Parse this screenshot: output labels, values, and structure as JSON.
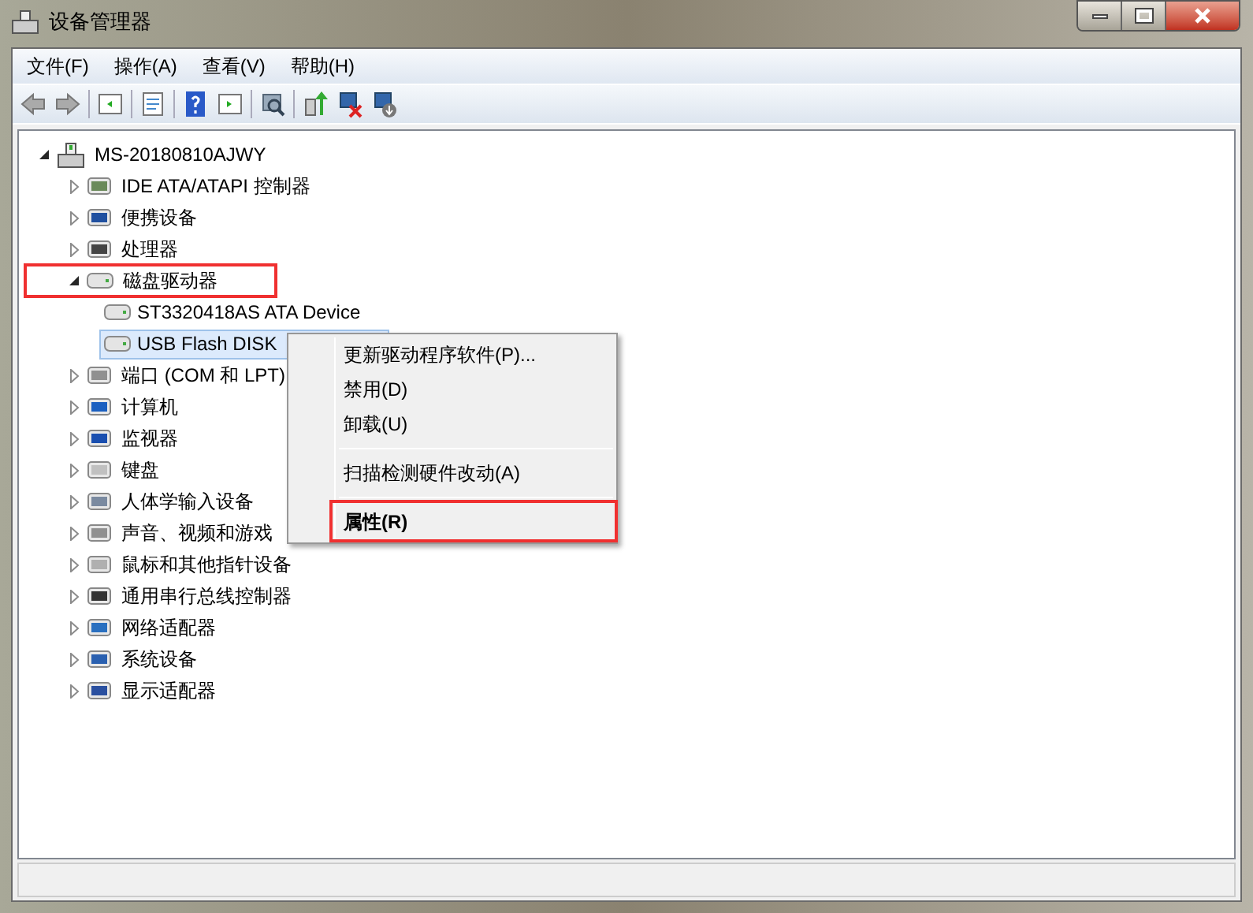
{
  "window": {
    "title": "设备管理器"
  },
  "menu": [
    "文件(F)",
    "操作(A)",
    "查看(V)",
    "帮助(H)"
  ],
  "tree": {
    "label": "MS-20180810AJWY",
    "expanded": true,
    "children": [
      {
        "label": "IDE ATA/ATAPI 控制器",
        "expanded": false,
        "annotated": false
      },
      {
        "label": "便携设备",
        "expanded": false,
        "annotated": false
      },
      {
        "label": "处理器",
        "expanded": false,
        "annotated": false
      },
      {
        "label": "磁盘驱动器",
        "expanded": true,
        "annotated": true,
        "children": [
          {
            "label": "ST3320418AS ATA Device",
            "selected": false
          },
          {
            "label": "USB Flash DISK",
            "selected": true
          }
        ]
      },
      {
        "label": "端口 (COM 和 LPT)",
        "expanded": false,
        "annotated": false
      },
      {
        "label": "计算机",
        "expanded": false,
        "annotated": false
      },
      {
        "label": "监视器",
        "expanded": false,
        "annotated": false
      },
      {
        "label": "键盘",
        "expanded": false,
        "annotated": false
      },
      {
        "label": "人体学输入设备",
        "expanded": false,
        "annotated": false
      },
      {
        "label": "声音、视频和游戏",
        "expanded": false,
        "annotated": false
      },
      {
        "label": "鼠标和其他指针设备",
        "expanded": false,
        "annotated": false
      },
      {
        "label": "通用串行总线控制器",
        "expanded": false,
        "annotated": false
      },
      {
        "label": "网络适配器",
        "expanded": false,
        "annotated": false
      },
      {
        "label": "系统设备",
        "expanded": false,
        "annotated": false
      },
      {
        "label": "显示适配器",
        "expanded": false,
        "annotated": false
      }
    ]
  },
  "context_menu": {
    "items": [
      {
        "kind": "item",
        "label": "更新驱动程序软件(P)...",
        "bold": false,
        "annotated": false
      },
      {
        "kind": "item",
        "label": "禁用(D)",
        "bold": false,
        "annotated": false
      },
      {
        "kind": "item",
        "label": "卸载(U)",
        "bold": false,
        "annotated": false
      },
      {
        "kind": "separator"
      },
      {
        "kind": "item",
        "label": "扫描检测硬件改动(A)",
        "bold": false,
        "annotated": false
      },
      {
        "kind": "separator"
      },
      {
        "kind": "item",
        "label": "属性(R)",
        "bold": true,
        "annotated": true
      }
    ]
  }
}
